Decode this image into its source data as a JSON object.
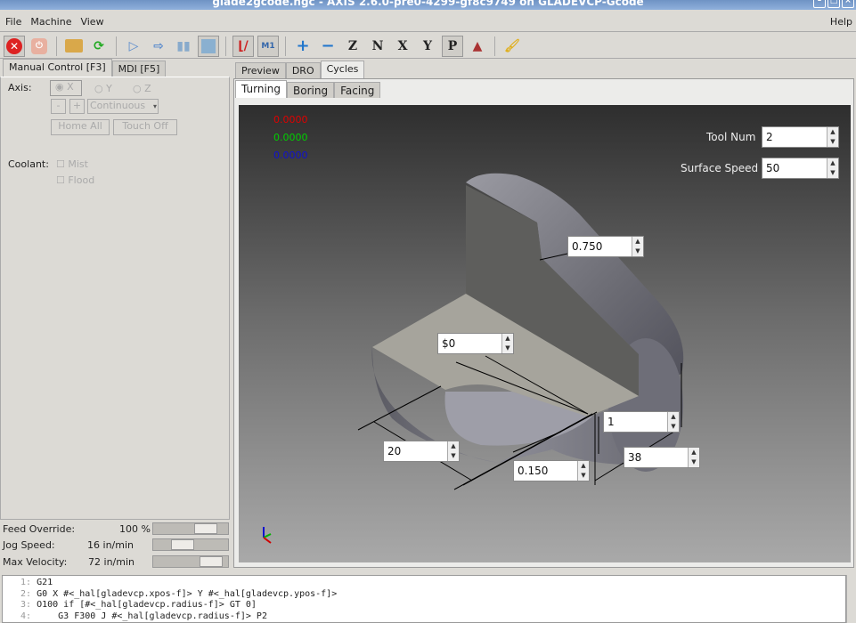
{
  "window": {
    "title": "glade2gcode.ngc - AXIS 2.6.0-pre0-4299-gf8c9749 on GLADEVCP-Gcode"
  },
  "menu": {
    "file": "File",
    "machine": "Machine",
    "view": "View",
    "help": "Help"
  },
  "toolbar": [
    {
      "icon": "estop-icon"
    },
    {
      "icon": "power-icon"
    },
    {
      "icon": "open-folder-icon"
    },
    {
      "icon": "reload-icon"
    },
    {
      "icon": "run-icon"
    },
    {
      "icon": "step-icon"
    },
    {
      "icon": "pause-icon"
    },
    {
      "icon": "stop-icon"
    },
    {
      "icon": "block-delete-icon"
    },
    {
      "icon": "optional-stop-icon"
    },
    {
      "icon": "zoom-in-icon"
    },
    {
      "icon": "zoom-out-icon"
    },
    {
      "icon": "view-z-icon"
    },
    {
      "icon": "view-z2-icon"
    },
    {
      "icon": "view-x-icon"
    },
    {
      "icon": "view-y-icon"
    },
    {
      "icon": "view-p-icon"
    },
    {
      "icon": "rotate-view-icon"
    },
    {
      "icon": "clear-plot-icon"
    }
  ],
  "left": {
    "tabs": [
      "Manual Control [F3]",
      "MDI [F5]"
    ],
    "axis_label": "Axis:",
    "axes": [
      "X",
      "Y",
      "Z"
    ],
    "selected_axis": "X",
    "jog_minus": "-",
    "jog_plus": "+",
    "jog_mode": "Continuous",
    "home_all": "Home All",
    "touch_off": "Touch Off",
    "coolant_label": "Coolant:",
    "mist": "Mist",
    "flood": "Flood",
    "feed_override_label": "Feed Override:",
    "feed_override": "100 %",
    "feed_override_frac": 0.8,
    "jog_speed_label": "Jog Speed:",
    "jog_speed": "16 in/min",
    "jog_speed_frac": 0.35,
    "max_velocity_label": "Max Velocity:",
    "max_velocity": "72 in/min",
    "max_velocity_frac": 0.9
  },
  "right": {
    "tabs": [
      "Preview",
      "DRO",
      "Cycles"
    ],
    "active_tab": "Cycles",
    "subtabs": [
      "Turning",
      "Boring",
      "Facing"
    ],
    "active_subtab": "Turning",
    "dro": [
      "0.0000",
      "0.0000",
      "0.0000"
    ],
    "tool_num_label": "Tool Num",
    "tool_num": "2",
    "surface_speed_label": "Surface Speed",
    "surface_speed": "50",
    "fields": {
      "radius": "0.750",
      "start": "$0",
      "depth": "1",
      "length": "20",
      "feed": "0.150",
      "diameter": "38"
    }
  },
  "colors": {
    "x": "#e00000",
    "y": "#00d000",
    "z": "#1010d0"
  },
  "code": [
    {
      "n": "1:",
      "t": "G21"
    },
    {
      "n": "2:",
      "t": "G0 X #<_hal[gladevcp.xpos-f]> Y #<_hal[gladevcp.ypos-f]>"
    },
    {
      "n": "3:",
      "t": "O100 if [#<_hal[gladevcp.radius-f]> GT 0]"
    },
    {
      "n": "4:",
      "t": "    G3 F300 J #<_hal[gladevcp.radius-f]> P2"
    }
  ]
}
